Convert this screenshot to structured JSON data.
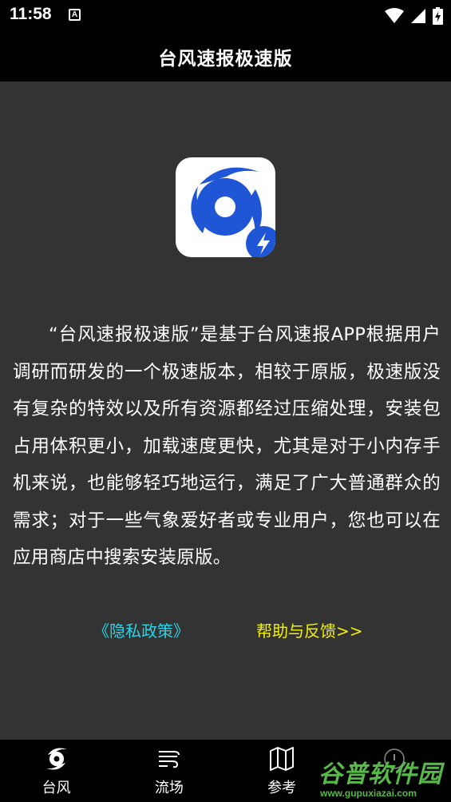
{
  "status_bar": {
    "time": "11:58",
    "notification_badge": "A",
    "icons": [
      "wifi-icon",
      "signal-icon",
      "battery-charging-icon"
    ]
  },
  "header": {
    "title": "台风速报极速版"
  },
  "logo": {
    "icon": "typhoon-bolt-logo",
    "colors": {
      "background": "#ffffff",
      "primary": "#1e56d6",
      "bolt": "#ffffff"
    }
  },
  "description": "“台风速报极速版”是基于台风速报APP根据用户调研而研发的一个极速版本，相较于原版，极速版没有复杂的特效以及所有资源都经过压缩处理，安装包占用体积更小，加载速度更快，尤其是对于小内存手机来说，也能够轻巧地运行，满足了广大普通群众的需求；对于一些气象爱好者或专业用户，您也可以在应用商店中搜索安装原版。",
  "links": {
    "privacy": "《隐私政策》",
    "help": "帮助与反馈>>"
  },
  "bottom_nav": [
    {
      "label": "台风",
      "icon": "typhoon-icon"
    },
    {
      "label": "流场",
      "icon": "wind-flow-icon"
    },
    {
      "label": "参考",
      "icon": "map-icon"
    },
    {
      "label": "",
      "icon": "info-icon"
    }
  ],
  "watermark": {
    "title": "谷普软件园",
    "url": "www.gupuxiazai.com"
  },
  "colors": {
    "page_background": "#333333",
    "bar_background": "#000000",
    "privacy_link": "#2ad4e6",
    "help_link": "#f2f200",
    "watermark": "#57b947"
  }
}
